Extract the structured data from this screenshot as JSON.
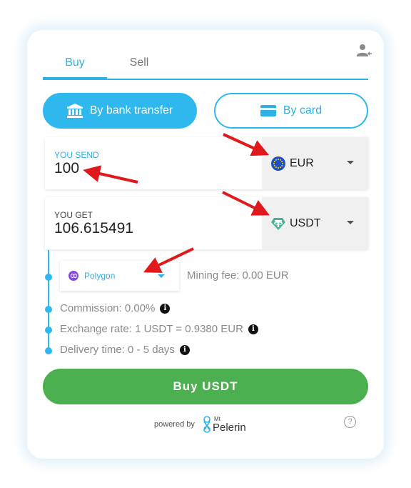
{
  "tabs": [
    {
      "label": "Buy",
      "active": true
    },
    {
      "label": "Sell",
      "active": false
    }
  ],
  "payment_methods": {
    "bank_transfer": "By bank transfer",
    "card": "By card",
    "selected": "bank_transfer"
  },
  "send": {
    "label": "YOU SEND",
    "amount": "100",
    "currency": "EUR",
    "currency_icon": "euro-flag-icon"
  },
  "receive": {
    "label": "YOU GET",
    "amount": "106.615491",
    "currency": "USDT",
    "currency_icon": "tether-icon"
  },
  "network": {
    "label": "Polygon",
    "icon": "polygon-icon"
  },
  "details": {
    "mining_fee": "Mining fee: 0.00 EUR",
    "commission": "Commission: 0.00%",
    "exchange_rate": "Exchange rate: 1 USDT = 0.9380 EUR",
    "delivery_time": "Delivery time: 0 - 5 days"
  },
  "actions": {
    "buy_label": "Buy USDT"
  },
  "footer": {
    "powered_by": "powered by",
    "brand_prefix": "Mt",
    "brand_name": "Pelerin",
    "help_symbol": "?"
  },
  "colors": {
    "accent": "#2fb8ee",
    "buy_button": "#4caf50",
    "annotation_arrow": "#e0191c",
    "tether_green": "#50af95",
    "euro_blue": "#1e4fbf",
    "polygon_purple": "#8247e5"
  }
}
